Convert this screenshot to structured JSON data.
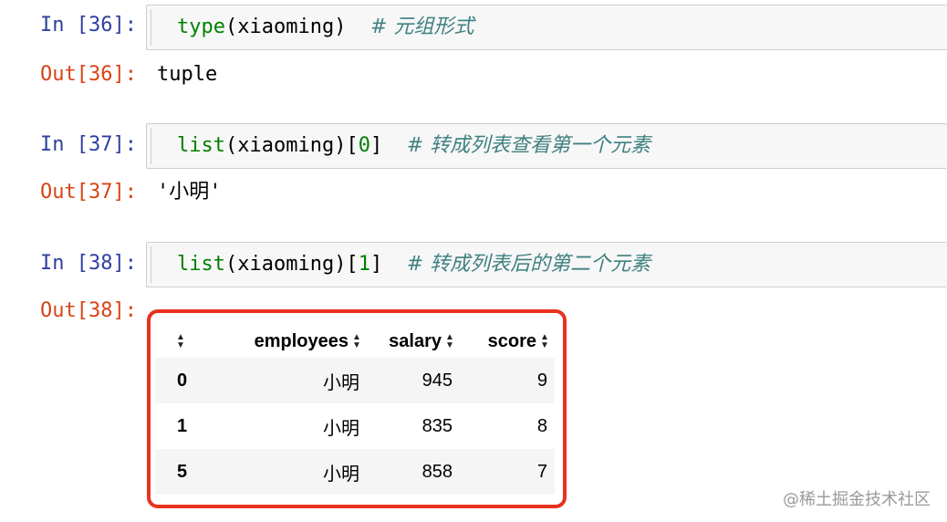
{
  "cells": [
    {
      "in_prompt": "In [36]:",
      "code": {
        "func": "type",
        "args": "(xiaoming)",
        "comment": "# 元组形式"
      },
      "out_prompt": "Out[36]:",
      "output": "tuple"
    },
    {
      "in_prompt": "In [37]:",
      "code": {
        "func": "list",
        "args": "(xiaoming)[",
        "index": "0",
        "close": "]",
        "comment": "# 转成列表查看第一个元素"
      },
      "out_prompt": "Out[37]:",
      "output": "'小明'"
    },
    {
      "in_prompt": "In [38]:",
      "code": {
        "func": "list",
        "args": "(xiaoming)[",
        "index": "1",
        "close": "]",
        "comment": "# 转成列表后的第二个元素"
      },
      "out_prompt": "Out[38]:"
    }
  ],
  "dataframe": {
    "columns": [
      "employees",
      "salary",
      "score"
    ],
    "rows": [
      {
        "index": "0",
        "employees": "小明",
        "salary": "945",
        "score": "9"
      },
      {
        "index": "1",
        "employees": "小明",
        "salary": "835",
        "score": "8"
      },
      {
        "index": "5",
        "employees": "小明",
        "salary": "858",
        "score": "7"
      }
    ]
  },
  "colors": {
    "highlight": "#e8321f",
    "in_prompt": "#303f9f",
    "out_prompt": "#d84315"
  },
  "watermark": "@稀土掘金技术社区"
}
